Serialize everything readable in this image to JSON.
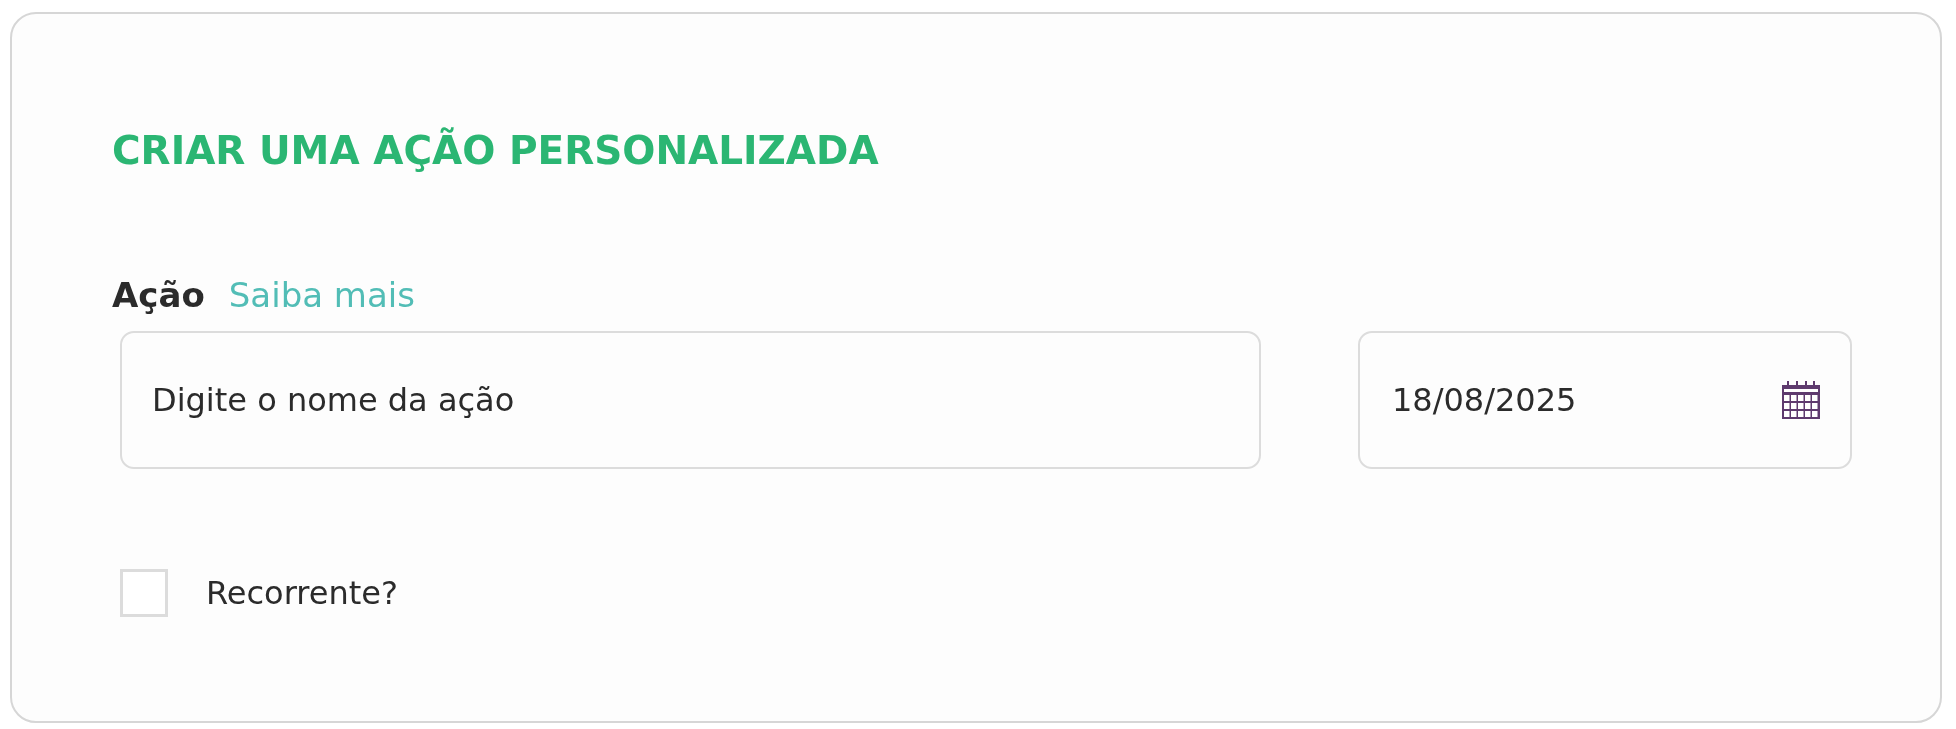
{
  "title": "CRIAR UMA AÇÃO PERSONALIZADA",
  "action_field": {
    "label": "Ação",
    "help_link": "Saiba mais",
    "placeholder": "Digite o nome da ação"
  },
  "date_field": {
    "value": "18/08/2025"
  },
  "recurring": {
    "label": "Recorrente?",
    "checked": false
  }
}
